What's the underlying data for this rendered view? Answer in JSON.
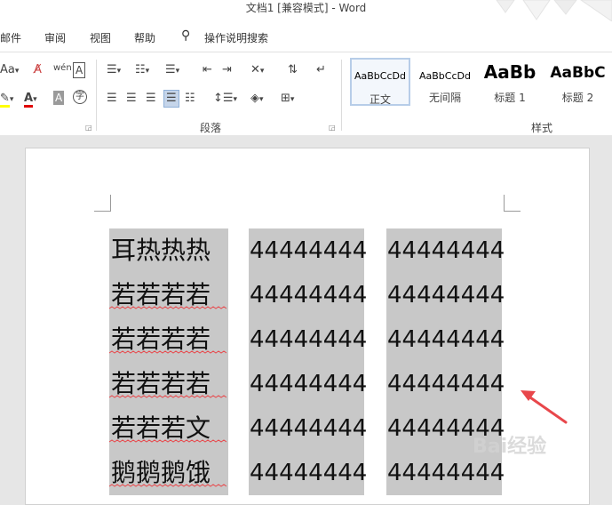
{
  "window": {
    "title": "文档1 [兼容模式]  -  Word"
  },
  "menu": {
    "items": [
      "邮件",
      "审阅",
      "视图",
      "帮助"
    ],
    "tell_me": "操作说明搜索"
  },
  "ribbon": {
    "font_group": {
      "aa_label": "Aa",
      "wen_label": "wén",
      "font_color_label": "A"
    },
    "paragraph_group_label": "段落",
    "styles_group_label": "样式",
    "styles": [
      {
        "sample": "AaBbCcDd",
        "name": "正文",
        "selected": true
      },
      {
        "sample": "AaBbCcDd",
        "name": "无间隔",
        "selected": false
      },
      {
        "sample": "AaBb",
        "name": "标题 1",
        "selected": false
      },
      {
        "sample": "AaBbC",
        "name": "标题 2",
        "selected": false
      }
    ]
  },
  "document": {
    "text_column": [
      "耳热热热",
      "若若若若",
      "若若若若",
      "若若若若",
      "若若若文",
      "鹅鹅鹅饿"
    ],
    "number_column_1": [
      "44444444",
      "44444444",
      "44444444",
      "44444444",
      "44444444",
      "44444444"
    ],
    "number_column_2": [
      "44444444",
      "44444444",
      "44444444",
      "44444444",
      "44444444",
      "44444444"
    ],
    "squiggle_rows": [
      1,
      2,
      3,
      4,
      5
    ]
  },
  "colors": {
    "accent_red": "#e8474b",
    "highlight_gray": "#c8c8c8",
    "highlight_yellow": "#ffff00",
    "font_red": "#e00000"
  },
  "watermark": {
    "text": "Bai经验"
  }
}
